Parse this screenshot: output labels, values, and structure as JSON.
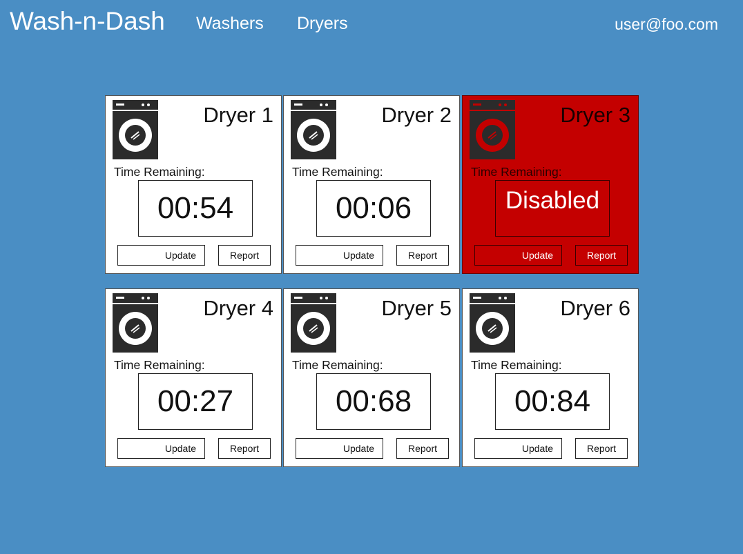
{
  "nav": {
    "brand": "Wash-n-Dash",
    "links": [
      "Washers",
      "Dryers"
    ],
    "user": "user@foo.com"
  },
  "colors": {
    "page_background": "#4a8ec4",
    "card_background": "#ffffff",
    "disabled_background": "#c40000",
    "icon_dark": "#2b2b2b",
    "icon_disabled_ring": "#c40000"
  },
  "labels": {
    "time_remaining": "Time Remaining:",
    "update": "Update",
    "report": "Report"
  },
  "dryers": [
    {
      "name": "Dryer 1",
      "time": "00:54",
      "disabled": false
    },
    {
      "name": "Dryer 2",
      "time": "00:06",
      "disabled": false
    },
    {
      "name": "Dryer 3",
      "time": "Disabled",
      "disabled": true
    },
    {
      "name": "Dryer 4",
      "time": "00:27",
      "disabled": false
    },
    {
      "name": "Dryer 5",
      "time": "00:68",
      "disabled": false
    },
    {
      "name": "Dryer 6",
      "time": "00:84",
      "disabled": false
    }
  ],
  "icon": "dryer-machine-icon"
}
